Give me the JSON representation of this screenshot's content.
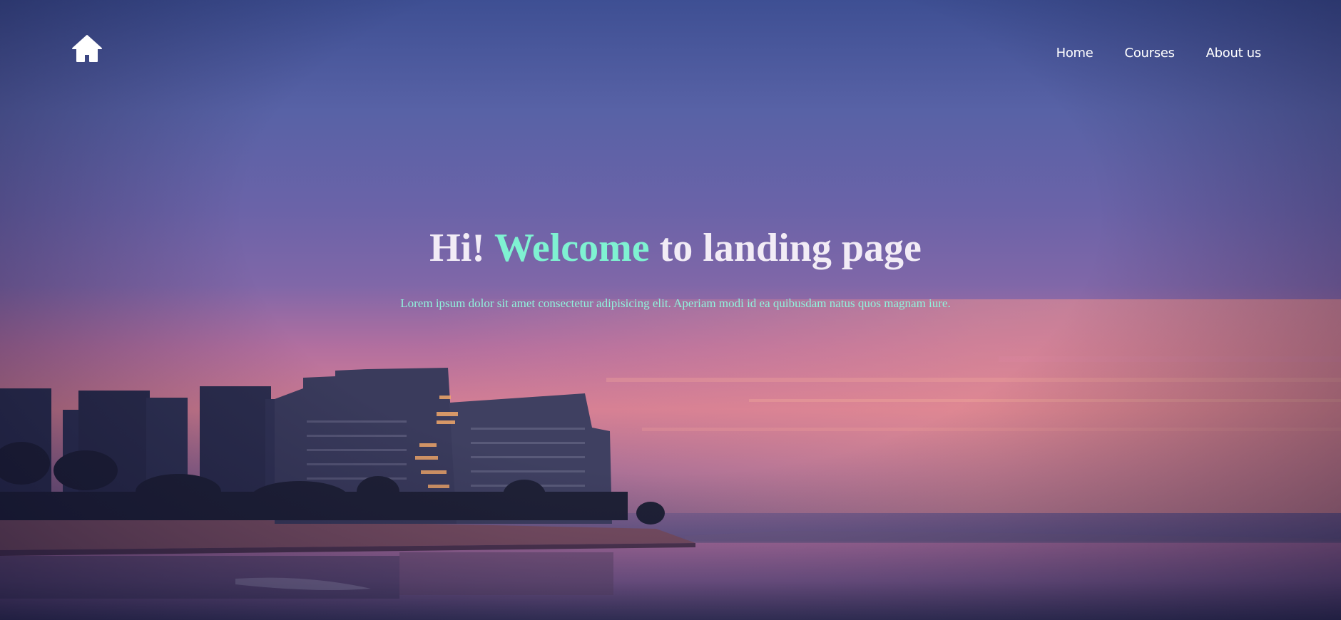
{
  "nav": {
    "logo_icon": "home-icon",
    "items": [
      {
        "label": "Home"
      },
      {
        "label": "Courses"
      },
      {
        "label": "About us"
      }
    ]
  },
  "hero": {
    "title_part1": "Hi! ",
    "title_accent": "Welcome",
    "title_part2": " to landing page",
    "subtitle": "Lorem ipsum dolor sit amet consectetur adipisicing elit. Aperiam modi id ea quibusdam natus quos magnam iure."
  },
  "colors": {
    "accent": "#7ff2d2",
    "title": "#f2ecf6",
    "nav_text": "#ffffff"
  }
}
